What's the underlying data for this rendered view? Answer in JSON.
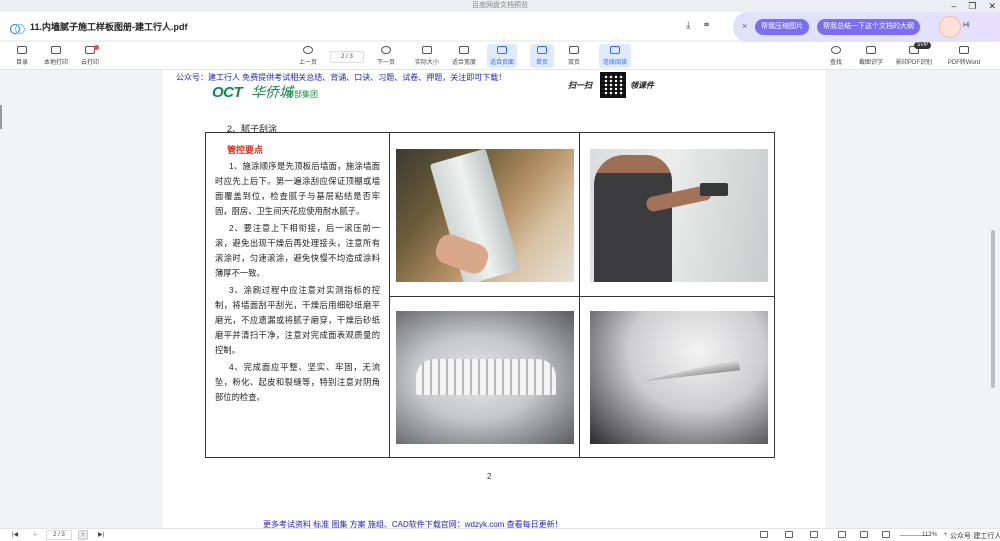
{
  "window": {
    "title": "百度网盘文档预览",
    "controls": [
      "–",
      "❐",
      "✕"
    ]
  },
  "tab": {
    "doc_title": "11.内墙腻子施工样板图册-建工行人.pdf"
  },
  "ai_panel": {
    "chip1": "帮我压缩图片",
    "chip2": "帮我总结一下这个文档的大纲",
    "greeting": "Hi",
    "close": "×"
  },
  "toolbar": {
    "outline": "目录",
    "local_print": "本地打印",
    "cloud_print": "云打印",
    "prev_page": "上一页",
    "page_indicator": "2 / 3",
    "next_page": "下一页",
    "actual_size": "实际大小",
    "fit_width": "适合宽度",
    "fit_page": "适合页面",
    "single_page": "单页",
    "double_page": "双页",
    "continuous": "连续阅读",
    "search": "查找",
    "screenshot_ocr": "截图识字",
    "pdf_ocr": "影印PDF识别",
    "svip_badge": "SVIP",
    "pdf_to_word": "PDF转Word"
  },
  "page": {
    "header_line": "公众号：建工行人 免费提供考试相关总结、背诵、口诀、习题、试卷、押题，关注即可下载！",
    "logo_oct": "OCT",
    "logo_cn": "华侨城",
    "logo_group": "中部集团",
    "scan_left": "扫一扫",
    "scan_right": "领课件",
    "section_title": "2、腻子刮涂",
    "key_heading": "管控要点",
    "para1": "1、施涂顺序是先顶板后墙面，施涂墙面时应先上后下。第一遍涂刮应保证顶棚或墙面覆盖到位，检查腻子与基层粘结是否牢固，厨房、卫生间天花应使用耐水腻子。",
    "para2": "2、要注意上下相衔接，后一滚压前一滚，避免出现干燥后再处理接头，注意所有滚涂时，匀速滚涂，避免快慢不均造成涂料薄厚不一致。",
    "para3": "3、涂刷过程中应注意对实测指标的控制，将墙面刮平刮光，干燥后用细砂纸磨平磨光，不应遗漏或将腻子磨穿，干燥后砂纸磨平并清扫干净，注意对完成面表观质量的控制。",
    "para4": "4、完成面应平整、坚实、牢固，无流坠，粉化、起皮和裂缝等，特别注意对阴角部位的检查。",
    "page_number": "2",
    "footer_line": "更多考试资料 标准 图集 方案 施组、CAD软件下载官网：wdzyk.com 查看每日更新！"
  },
  "statusbar": {
    "page_indicator": "2 / 3",
    "zoom": "113%",
    "watermark": "公众号·建工行人"
  }
}
